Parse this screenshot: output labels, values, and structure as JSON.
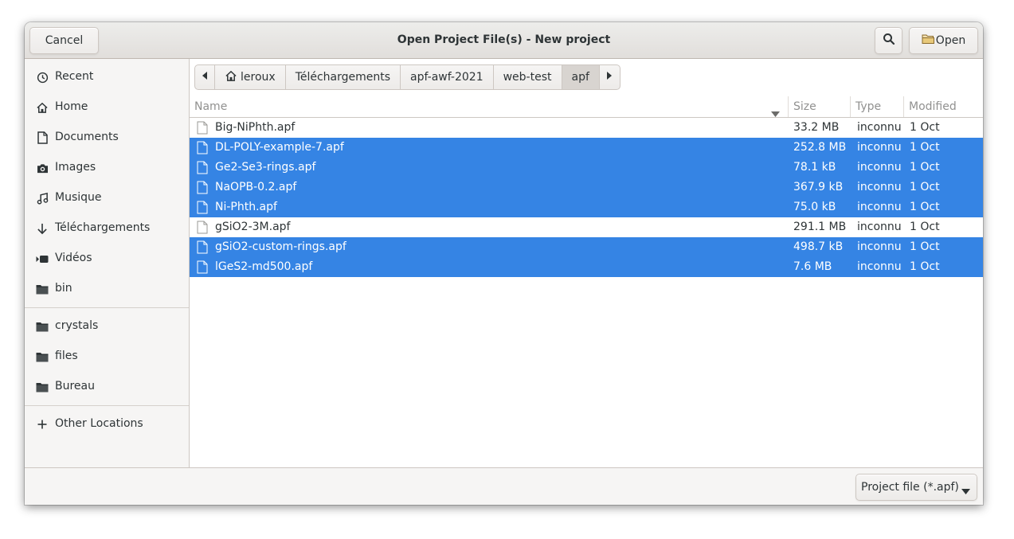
{
  "header": {
    "title": "Open Project File(s) - New project",
    "cancel_label": "Cancel",
    "open_label": "Open"
  },
  "sidebar": {
    "items": [
      {
        "label": "Recent",
        "icon": "clock-icon"
      },
      {
        "label": "Home",
        "icon": "home-icon"
      },
      {
        "label": "Documents",
        "icon": "document-icon"
      },
      {
        "label": "Images",
        "icon": "camera-icon"
      },
      {
        "label": "Musique",
        "icon": "music-icon"
      },
      {
        "label": "Téléchargements",
        "icon": "download-icon"
      },
      {
        "label": "Vidéos",
        "icon": "video-icon"
      },
      {
        "label": "bin",
        "icon": "folder-icon"
      },
      {
        "label": "crystals",
        "icon": "folder-icon"
      },
      {
        "label": "files",
        "icon": "folder-icon"
      },
      {
        "label": "Bureau",
        "icon": "folder-icon"
      },
      {
        "label": "Other Locations",
        "icon": "plus-icon"
      }
    ]
  },
  "pathbar": {
    "crumbs": [
      "leroux",
      "Téléchargements",
      "apf-awf-2021",
      "web-test",
      "apf"
    ],
    "active": "apf"
  },
  "columns": {
    "name": "Name",
    "size": "Size",
    "type": "Type",
    "modified": "Modified"
  },
  "files": [
    {
      "name": "Big-NiPhth.apf",
      "size": "33.2 MB",
      "type": "inconnu",
      "modified": "1 Oct",
      "selected": false
    },
    {
      "name": "DL-POLY-example-7.apf",
      "size": "252.8 MB",
      "type": "inconnu",
      "modified": "1 Oct",
      "selected": true
    },
    {
      "name": "Ge2-Se3-rings.apf",
      "size": "78.1 kB",
      "type": "inconnu",
      "modified": "1 Oct",
      "selected": true
    },
    {
      "name": "NaOPB-0.2.apf",
      "size": "367.9 kB",
      "type": "inconnu",
      "modified": "1 Oct",
      "selected": true
    },
    {
      "name": "Ni-Phth.apf",
      "size": "75.0 kB",
      "type": "inconnu",
      "modified": "1 Oct",
      "selected": true
    },
    {
      "name": "gSiO2-3M.apf",
      "size": "291.1 MB",
      "type": "inconnu",
      "modified": "1 Oct",
      "selected": false
    },
    {
      "name": "gSiO2-custom-rings.apf",
      "size": "498.7 kB",
      "type": "inconnu",
      "modified": "1 Oct",
      "selected": true
    },
    {
      "name": "lGeS2-md500.apf",
      "size": "7.6 MB",
      "type": "inconnu",
      "modified": "1 Oct",
      "selected": true
    }
  ],
  "footer": {
    "filter_label": "Project file (*.apf)"
  },
  "colors": {
    "selection": "#3584e4",
    "headerbar": "#e1dedb",
    "sidebar": "#f6f5f4"
  }
}
